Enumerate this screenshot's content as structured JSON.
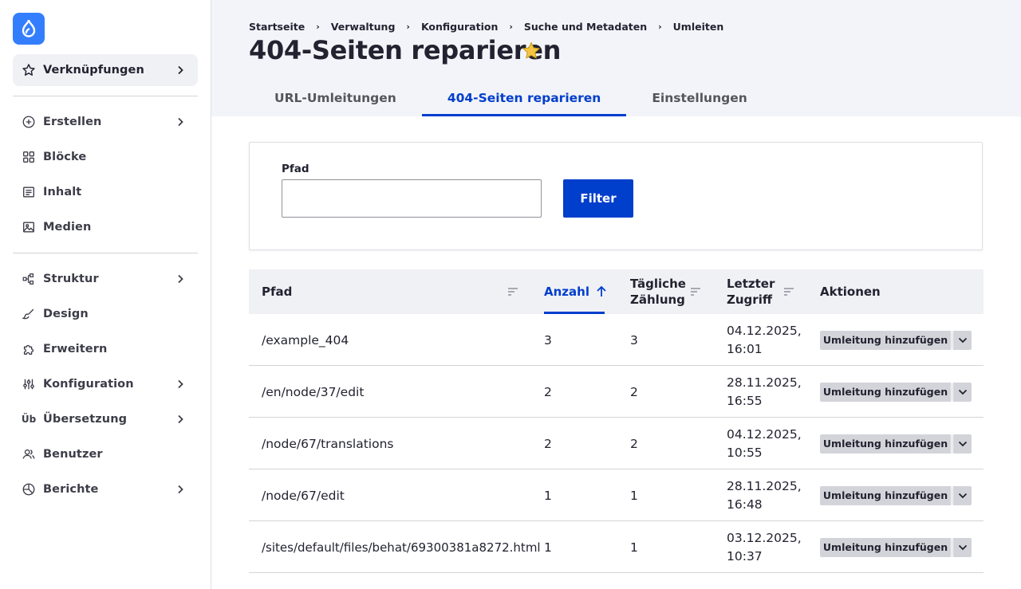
{
  "sidebar": {
    "shortcut_label": "Verknüpfungen",
    "groups": [
      {
        "items": [
          {
            "label": "Erstellen",
            "icon": "plus-circle-icon",
            "has_children": true
          },
          {
            "label": "Blöcke",
            "icon": "grid-icon",
            "has_children": false
          },
          {
            "label": "Inhalt",
            "icon": "content-icon",
            "has_children": false
          },
          {
            "label": "Medien",
            "icon": "media-icon",
            "has_children": false
          }
        ]
      },
      {
        "items": [
          {
            "label": "Struktur",
            "icon": "structure-icon",
            "has_children": true
          },
          {
            "label": "Design",
            "icon": "brush-icon",
            "has_children": false
          },
          {
            "label": "Erweitern",
            "icon": "puzzle-icon",
            "has_children": false
          },
          {
            "label": "Konfiguration",
            "icon": "sliders-icon",
            "has_children": true
          },
          {
            "label": "Übersetzung",
            "icon": "translate-icon",
            "icon_text": "Üb",
            "has_children": true
          },
          {
            "label": "Benutzer",
            "icon": "users-icon",
            "has_children": false
          },
          {
            "label": "Berichte",
            "icon": "reports-icon",
            "has_children": true
          }
        ]
      }
    ]
  },
  "breadcrumb": [
    "Startseite",
    "Verwaltung",
    "Konfiguration",
    "Suche und Metadaten",
    "Umleiten"
  ],
  "page_title": "404-Seiten reparieren",
  "tabs": [
    {
      "label": "URL-Umleitungen",
      "active": false
    },
    {
      "label": "404-Seiten reparieren",
      "active": true
    },
    {
      "label": "Einstellungen",
      "active": false
    }
  ],
  "filter": {
    "label": "Pfad",
    "value": "",
    "button_label": "Filter"
  },
  "table": {
    "headers": {
      "path": "Pfad",
      "count": "Anzahl",
      "daily_1": "Tägliche",
      "daily_2": "Zählung",
      "last_1": "Letzter",
      "last_2": "Zugriff",
      "actions": "Aktionen"
    },
    "rows": [
      {
        "path": "/example_404",
        "count": "3",
        "daily": "3",
        "date": "04.12.2025,",
        "time": "16:01",
        "action": "Umleitung hinzufügen"
      },
      {
        "path": "/en/node/37/edit",
        "count": "2",
        "daily": "2",
        "date": "28.11.2025,",
        "time": "16:55",
        "action": "Umleitung hinzufügen"
      },
      {
        "path": "/node/67/translations",
        "count": "2",
        "daily": "2",
        "date": "04.12.2025,",
        "time": "10:55",
        "action": "Umleitung hinzufügen"
      },
      {
        "path": "/node/67/edit",
        "count": "1",
        "daily": "1",
        "date": "28.11.2025,",
        "time": "16:48",
        "action": "Umleitung hinzufügen"
      },
      {
        "path": "/sites/default/files/behat/69300381a8272.html",
        "count": "1",
        "daily": "1",
        "date": "03.12.2025,",
        "time": "10:37",
        "action": "Umleitung hinzufügen"
      }
    ]
  },
  "colors": {
    "accent": "#003ecc",
    "logo": "#347efe",
    "star": "#f4c543"
  }
}
